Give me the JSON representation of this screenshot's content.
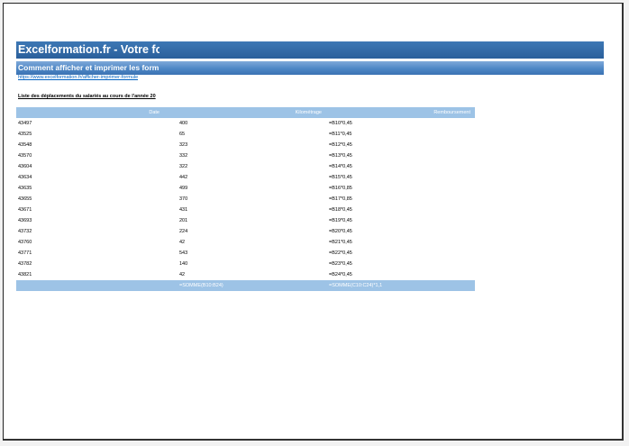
{
  "banner": {
    "title": "Excelformation.fr - Votre for",
    "subtitle": "Comment afficher et imprimer les form"
  },
  "link": "https://www.excelformation.fr/afficher-imprimer-formule",
  "caption": "Liste des déplacements du salariés au cours de l'année 20",
  "table": {
    "headers": [
      "Date",
      "Kilométrage",
      "Remboursement"
    ],
    "rows": [
      [
        "43497",
        "400",
        "=B10*0,45"
      ],
      [
        "43525",
        "65",
        "=B11*0,45"
      ],
      [
        "43548",
        "323",
        "=B12*0,45"
      ],
      [
        "43570",
        "332",
        "=B13*0,45"
      ],
      [
        "43604",
        "322",
        "=B14*0,45"
      ],
      [
        "43634",
        "442",
        "=B15*0,45"
      ],
      [
        "43635",
        "499",
        "=B16*0,85"
      ],
      [
        "43655",
        "370",
        "=B17*0,85"
      ],
      [
        "43671",
        "431",
        "=B18*0,45"
      ],
      [
        "43693",
        "201",
        "=B19*0,45"
      ],
      [
        "43732",
        "224",
        "=B20*0,45"
      ],
      [
        "43760",
        "42",
        "=B21*0,45"
      ],
      [
        "43771",
        "543",
        "=B22*0,45"
      ],
      [
        "43782",
        "140",
        "=B23*0,45"
      ],
      [
        "43821",
        "42",
        "=B24*0,45"
      ]
    ],
    "total": [
      "",
      "=SOMME(B10:B24)",
      "=SOMME(C10:C24)*1,1"
    ]
  }
}
